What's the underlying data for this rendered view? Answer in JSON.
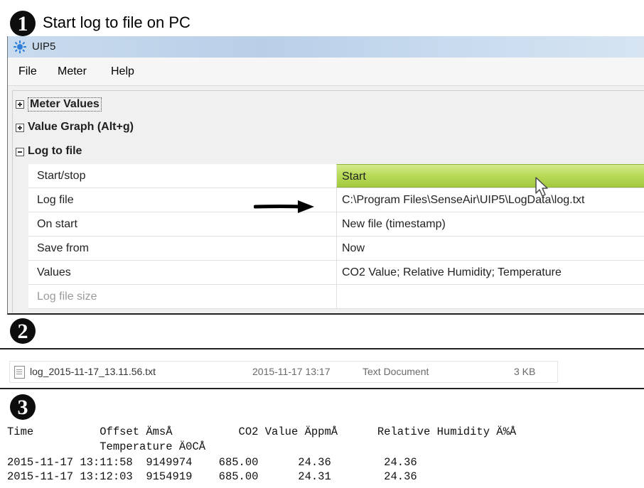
{
  "steps": {
    "one": {
      "number": "1",
      "title": "Start log to file on PC"
    },
    "two": {
      "number": "2"
    },
    "three": {
      "number": "3"
    }
  },
  "window": {
    "title": "UIP5",
    "menu": [
      "File",
      "Meter",
      "Help"
    ]
  },
  "categories": {
    "meter_values": "Meter Values",
    "value_graph": "Value Graph (Alt+g)",
    "log_to_file": "Log to file"
  },
  "properties": [
    {
      "name": "Start/stop",
      "value": "Start"
    },
    {
      "name": "Log file",
      "value": "C:\\Program Files\\SenseAir\\UIP5\\LogData\\log.txt"
    },
    {
      "name": "On start",
      "value": "New file (timestamp)"
    },
    {
      "name": "Save from",
      "value": "Now"
    },
    {
      "name": "Values",
      "value": "CO2 Value; Relative Humidity; Temperature"
    },
    {
      "name": "Log file size",
      "value": ""
    }
  ],
  "file": {
    "name": "log_2015-11-17_13.11.56.txt",
    "modified": "2015-11-17 13:17",
    "type": "Text Document",
    "size": "3 KB"
  },
  "log": {
    "header1": "Time          Offset ÄmsÅ          CO2 Value ÄppmÅ      Relative Humidity Ä%Å",
    "header2": "              Temperature Ä0CÅ",
    "rows": [
      "2015-11-17 13:11:58  9149974    685.00      24.36        24.36",
      "2015-11-17 13:12:03  9154919    685.00      24.31        24.36"
    ]
  },
  "colors": {
    "start_button": "#b9db5a",
    "titlebar": "#c4d8ee"
  }
}
